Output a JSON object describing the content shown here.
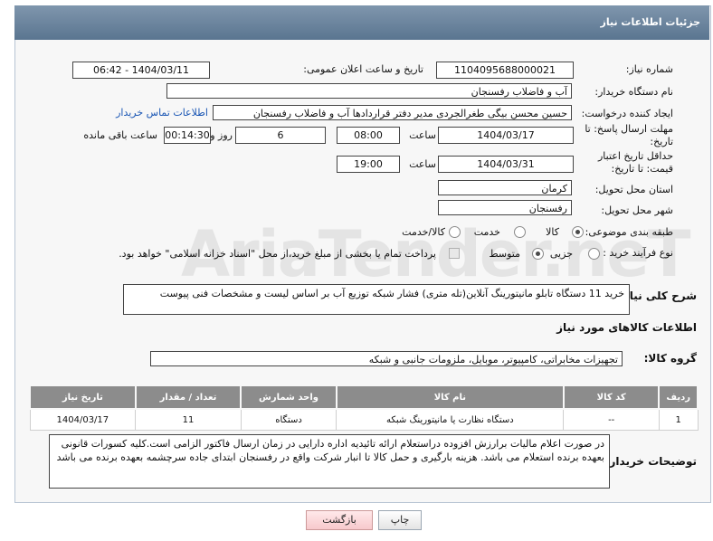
{
  "header": {
    "title": "جزئیات اطلاعات نیاز"
  },
  "fields": {
    "need_number_label": "شماره نیاز:",
    "need_number": "1104095688000021",
    "announce_label": "تاریخ و ساعت اعلان عمومی:",
    "announce_value": "1404/03/11 - 06:42",
    "buyer_org_label": "نام دستگاه خریدار:",
    "buyer_org": "آب و فاضلاب رفسنجان",
    "requester_label": "ایجاد کننده درخواست:",
    "requester": "حسین محسن بیگی طغرالجردی مدیر دفتر قراردادها آب و فاضلاب رفسنجان",
    "contact_link": "اطلاعات تماس خریدار",
    "deadline_label": "مهلت ارسال پاسخ: تا تاریخ:",
    "deadline_date": "1404/03/17",
    "time_label": "ساعت",
    "deadline_time": "08:00",
    "days_value": "6",
    "days_label": "روز و",
    "remaining_time": "00:14:30",
    "remaining_label": "ساعت باقی مانده",
    "validity_label": "حداقل تاریخ اعتبار قیمت: تا تاریخ:",
    "validity_date": "1404/03/31",
    "validity_time": "19:00",
    "province_label": "استان محل تحویل:",
    "province": "کرمان",
    "city_label": "شهر محل تحویل:",
    "city": "رفسنجان",
    "category_label": "طبقه بندی موضوعی:",
    "category_options": [
      "کالا",
      "خدمت",
      "کالا/خدمت"
    ],
    "process_label": "نوع فرآیند خرید :",
    "process_options": [
      "جزیی",
      "متوسط"
    ],
    "payment_note": "پرداخت تمام یا بخشی از مبلغ خرید،از محل \"اسناد خزانه اسلامی\" خواهد بود."
  },
  "summary": {
    "label": "شرح کلی نیاز:",
    "text": "خرید 11 دستگاه تابلو مانیتورینگ آنلاین(تله متری) فشار شبکه توزیع آب بر اساس لیست و مشخصات فنی پیوست"
  },
  "goods": {
    "section_title": "اطلاعات کالاهای مورد نیاز",
    "group_label": "گروه کالا:",
    "group_value": "تجهیزات مخابراتی، کامپیوتر، موبایل، ملزومات جانبی و شبکه",
    "columns": [
      "ردیف",
      "کد کالا",
      "نام کالا",
      "واحد شمارش",
      "تعداد / مقدار",
      "تاریخ نیاز"
    ],
    "rows": [
      [
        "1",
        "--",
        "دستگاه نظارت یا مانیتورینگ شبکه",
        "دستگاه",
        "11",
        "1404/03/17"
      ]
    ]
  },
  "buyer_notes": {
    "label": "توضیحات خریدار:",
    "text": "در صورت اعلام مالیات برارزش افزوده دراستعلام ارائه تائیدیه اداره دارایی در زمان ارسال فاکتور الزامی است.کلیه کسورات قانونی بعهده برنده استعلام می باشد. هزینه بارگیری و حمل کالا تا انبار شرکت واقع در رفسنجان ابتدای جاده سرچشمه بعهده برنده می باشد"
  },
  "buttons": {
    "print": "چاپ",
    "back": "بازگشت"
  },
  "watermark": "AriaTender.neT",
  "colors": {
    "header": "#6b84a0",
    "link": "#1a56b4",
    "table_head": "#8c8c8c"
  }
}
